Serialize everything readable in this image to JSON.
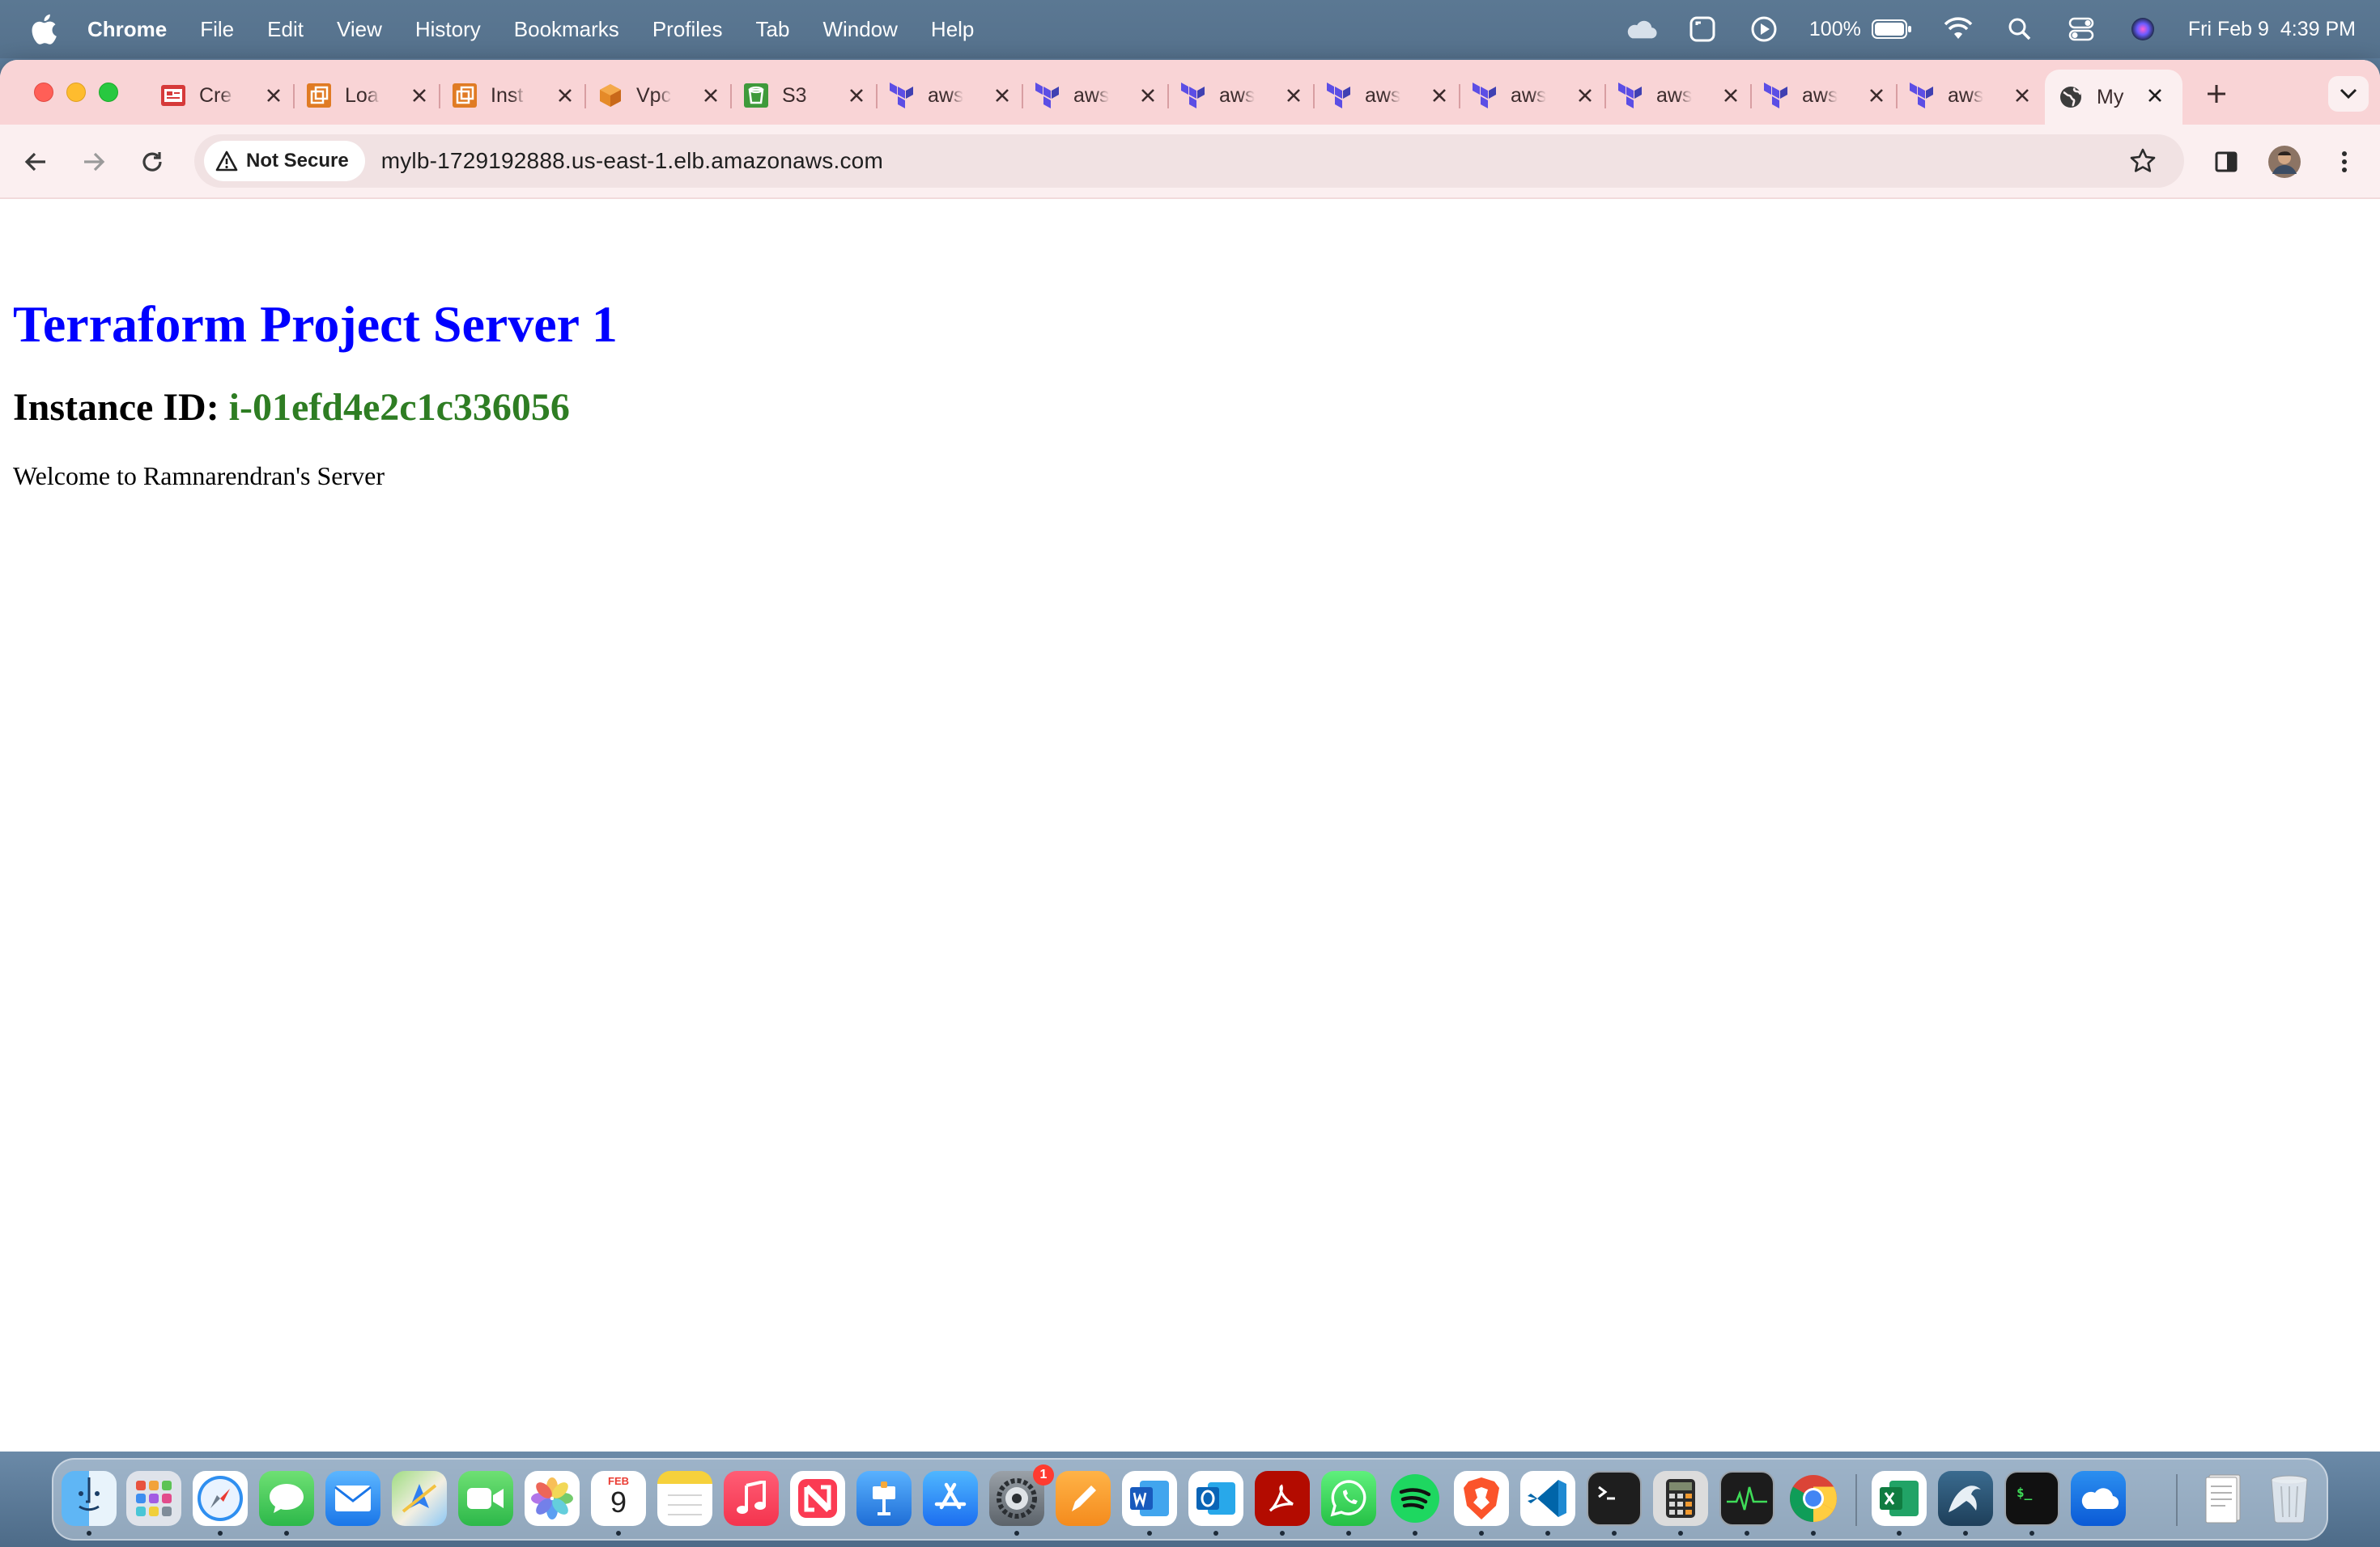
{
  "menubar": {
    "app_name": "Chrome",
    "menus": [
      "File",
      "Edit",
      "View",
      "History",
      "Bookmarks",
      "Profiles",
      "Tab",
      "Window",
      "Help"
    ],
    "battery": "100%",
    "date": "Fri Feb 9",
    "time": "4:39 PM"
  },
  "tabs": [
    {
      "title": "Cre",
      "icon": "aws-console-red-icon",
      "active": false
    },
    {
      "title": "Loa",
      "icon": "aws-ec2-orange-icon",
      "active": false
    },
    {
      "title": "Inst",
      "icon": "aws-ec2-orange-icon",
      "active": false
    },
    {
      "title": "Vpc",
      "icon": "aws-vpc-cube-icon",
      "active": false
    },
    {
      "title": "S3",
      "icon": "aws-s3-green-icon",
      "active": false
    },
    {
      "title": "aws",
      "icon": "terraform-icon",
      "active": false
    },
    {
      "title": "aws",
      "icon": "terraform-icon",
      "active": false
    },
    {
      "title": "aws",
      "icon": "terraform-icon",
      "active": false
    },
    {
      "title": "aws",
      "icon": "terraform-icon",
      "active": false
    },
    {
      "title": "aws",
      "icon": "terraform-icon",
      "active": false
    },
    {
      "title": "aws",
      "icon": "terraform-icon",
      "active": false
    },
    {
      "title": "aws",
      "icon": "terraform-icon",
      "active": false
    },
    {
      "title": "aws",
      "icon": "terraform-icon",
      "active": false
    },
    {
      "title": "My",
      "icon": "globe-icon",
      "active": true
    }
  ],
  "toolbar": {
    "security_label": "Not Secure",
    "url": "mylb-1729192888.us-east-1.elb.amazonaws.com"
  },
  "page": {
    "title": "Terraform Project Server 1",
    "instance_label": "Instance ID: ",
    "instance_id": "i-01efd4e2c1c336056",
    "welcome": "Welcome to Ramnarendran's Server"
  },
  "dock": {
    "apps": [
      "finder",
      "launchpad",
      "safari",
      "messages",
      "mail",
      "maps",
      "facetime",
      "photos",
      "calendar",
      "notes",
      "music",
      "news",
      "keynote",
      "app-store",
      "system-settings",
      "pages",
      "word",
      "outlook",
      "acrobat",
      "whatsapp",
      "spotify",
      "brave",
      "vscode",
      "terminal",
      "calculator",
      "activity-monitor",
      "chrome",
      "excel",
      "mysql-workbench",
      "iterm",
      "onedrive",
      "documents",
      "trash"
    ],
    "calendar_month": "FEB",
    "calendar_day": "9",
    "settings_badge": "1"
  },
  "colors": {
    "tabstrip": "#f9d4d6",
    "toolbar": "#fbeff0",
    "title_blue": "#0000ff",
    "instance_green": "#2e7d23"
  }
}
